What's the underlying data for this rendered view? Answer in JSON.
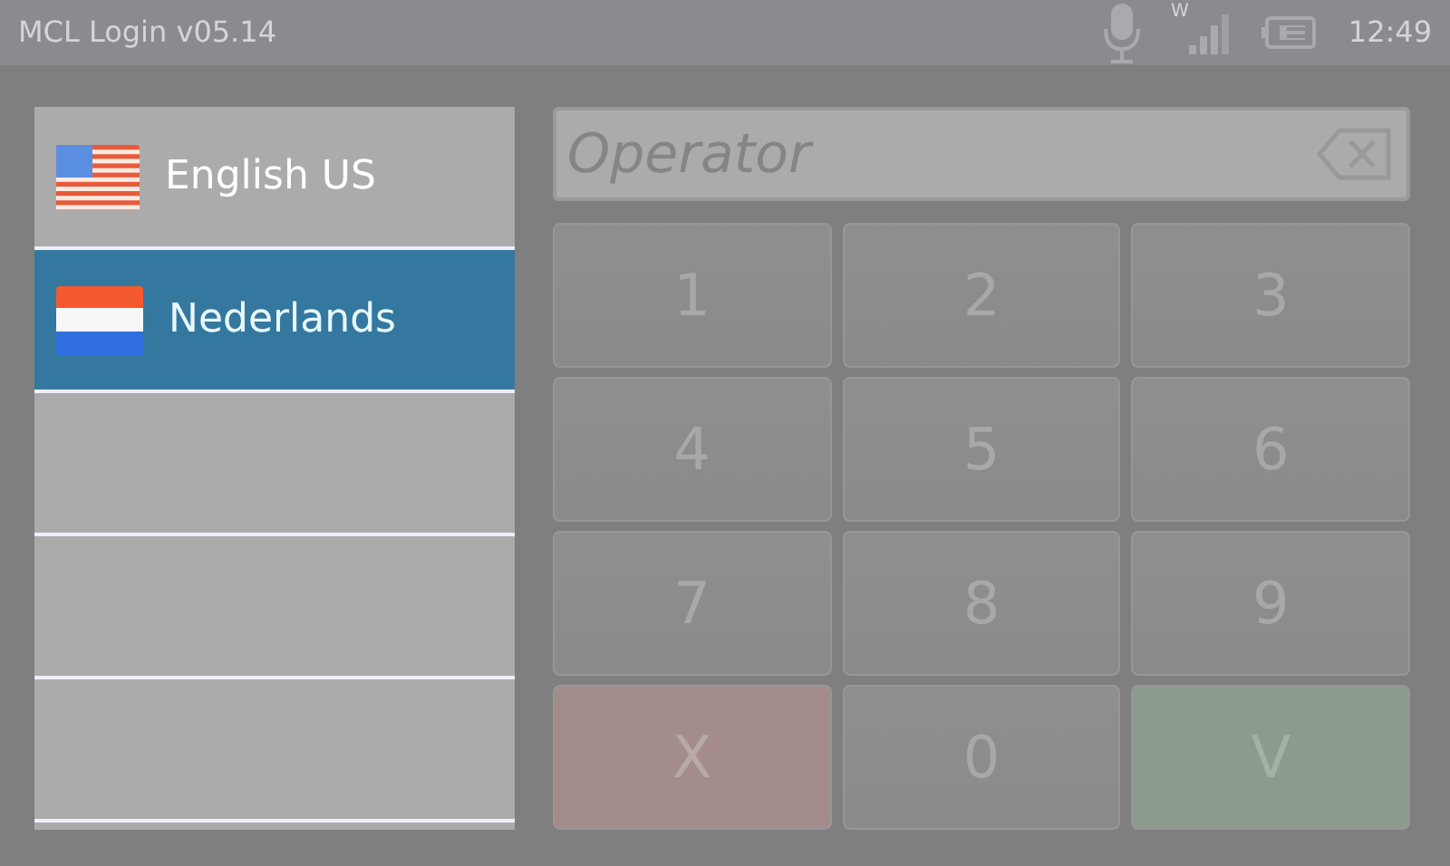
{
  "status_bar": {
    "title": "MCL Login v05.14",
    "network_label": "W",
    "time": "12:49"
  },
  "languages": [
    {
      "label": "English US",
      "kind": "us",
      "selected": false
    },
    {
      "label": "Nederlands",
      "kind": "nl",
      "selected": true
    },
    {
      "kind": "empty",
      "selected": false
    },
    {
      "kind": "empty",
      "selected": false
    },
    {
      "kind": "empty",
      "selected": false
    }
  ],
  "operator_field": {
    "placeholder": "Operator"
  },
  "keys": [
    {
      "label": "1",
      "kind": "digit"
    },
    {
      "label": "2",
      "kind": "digit"
    },
    {
      "label": "3",
      "kind": "digit"
    },
    {
      "label": "4",
      "kind": "digit"
    },
    {
      "label": "5",
      "kind": "digit"
    },
    {
      "label": "6",
      "kind": "digit"
    },
    {
      "label": "7",
      "kind": "digit"
    },
    {
      "label": "8",
      "kind": "digit"
    },
    {
      "label": "9",
      "kind": "digit"
    },
    {
      "label": "X",
      "kind": "cancel"
    },
    {
      "label": "0",
      "kind": "digit"
    },
    {
      "label": "V",
      "kind": "confirm"
    }
  ]
}
